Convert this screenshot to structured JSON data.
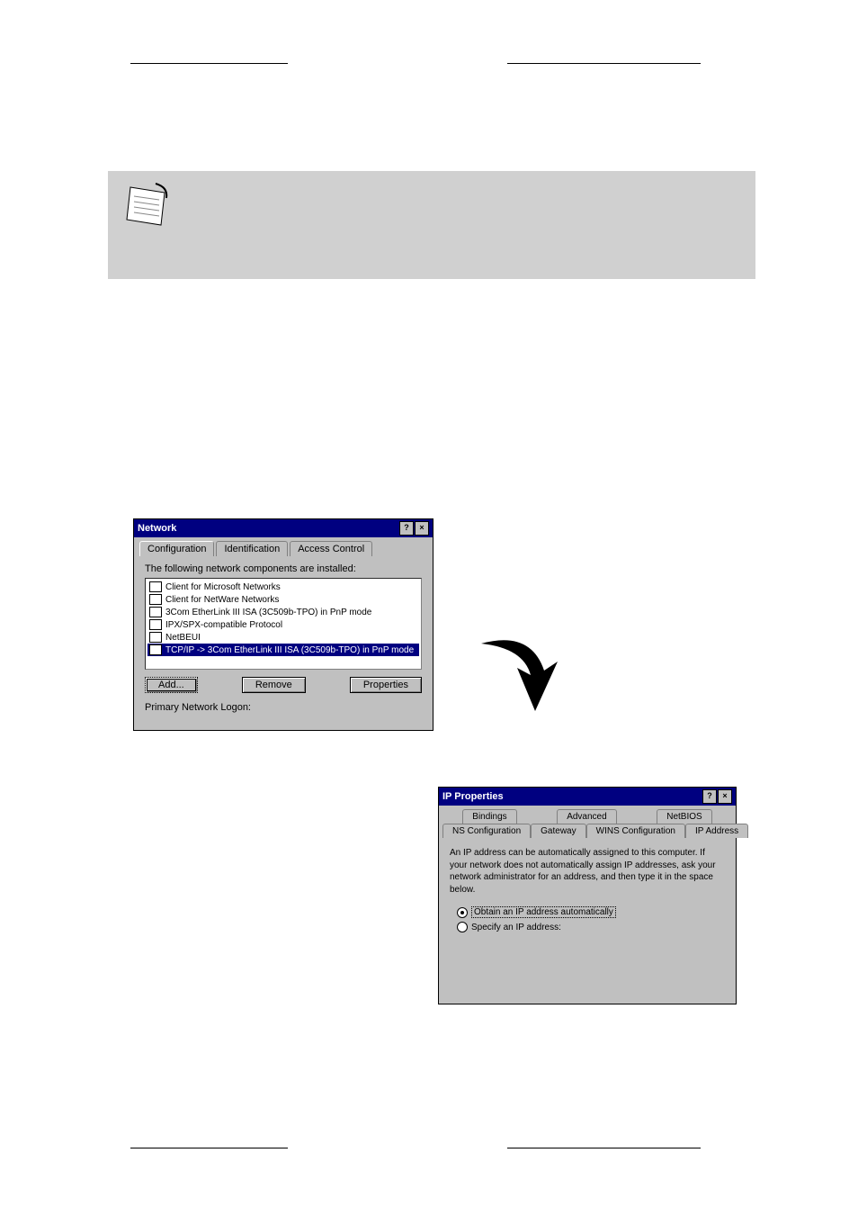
{
  "network_dialog": {
    "title": "Network",
    "help_btn": "?",
    "close_btn": "×",
    "tabs": {
      "configuration": "Configuration",
      "identification": "Identification",
      "access_control": "Access Control"
    },
    "components_label": "The following network components are installed:",
    "items": [
      "Client for Microsoft Networks",
      "Client for NetWare Networks",
      "3Com EtherLink III ISA (3C509b-TPO) in PnP mode",
      "IPX/SPX-compatible Protocol",
      "NetBEUI",
      "TCP/IP -> 3Com EtherLink III ISA (3C509b-TPO) in PnP mode"
    ],
    "buttons": {
      "add": "Add...",
      "remove": "Remove",
      "properties": "Properties"
    },
    "primary_logon_label": "Primary Network Logon:"
  },
  "ip_dialog": {
    "title": "IP Properties",
    "help_btn": "?",
    "close_btn": "×",
    "tabs_row1": {
      "bindings": "Bindings",
      "advanced": "Advanced",
      "netbios": "NetBIOS"
    },
    "tabs_row2": {
      "ns_config": "NS Configuration",
      "gateway": "Gateway",
      "wins_config": "WINS Configuration",
      "ip_address": "IP Address"
    },
    "description": "An IP address can be automatically assigned to this computer. If your network does not automatically assign IP addresses, ask your network administrator for an address, and then type it in the space below.",
    "radio_auto": "Obtain an IP address automatically",
    "radio_specify": "Specify an IP address:"
  }
}
